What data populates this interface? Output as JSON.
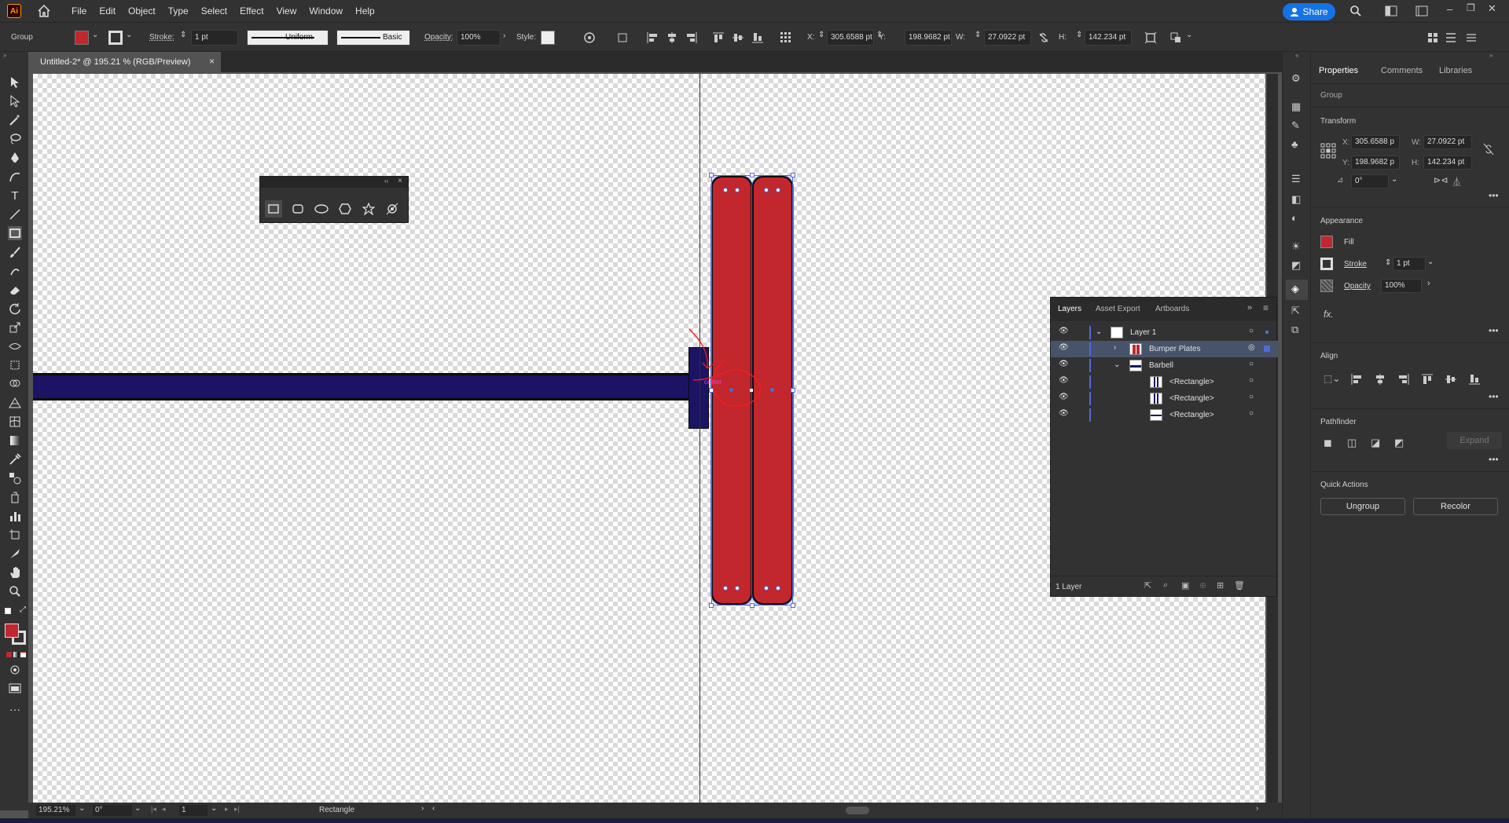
{
  "app": {
    "logo": "Ai",
    "home_icon": "home-icon"
  },
  "menu": [
    "File",
    "Edit",
    "Object",
    "Type",
    "Select",
    "Effect",
    "View",
    "Window",
    "Help"
  ],
  "share_label": "Share",
  "control_bar": {
    "selection_type": "Group",
    "fill_color": "#c1272d",
    "stroke_label": "Stroke:",
    "stroke_value": "1 pt",
    "profile_label": "Uniform",
    "brush_label": "Basic",
    "opacity_label": "Opacity:",
    "opacity_value": "100%",
    "style_label": "Style:",
    "x_label": "X:",
    "x_value": "305.6588 pt",
    "y_label": "Y:",
    "y_value": "198.9682 pt",
    "w_label": "W:",
    "w_value": "27.0922 pt",
    "h_label": "H:",
    "h_value": "142.234 pt"
  },
  "document_tab": {
    "title": "Untitled-2* @ 195.21 % (RGB/Preview)",
    "close": "×"
  },
  "canvas": {
    "bar_color": "#1b1464",
    "plate_color": "#c1272d",
    "annotation_color": "#ff1a1a",
    "center_label": "center"
  },
  "shape_popup": {
    "collapse": "‹‹",
    "close": "×"
  },
  "properties": {
    "tabs": [
      "Properties",
      "Comments",
      "Libraries"
    ],
    "selection": "Group",
    "transform_title": "Transform",
    "x_label": "X:",
    "x_value": "305.6588 p",
    "y_label": "Y:",
    "y_value": "198.9682 p",
    "w_label": "W:",
    "w_value": "27.0922 pt",
    "h_label": "H:",
    "h_value": "142.234 pt",
    "rotate_value": "0°",
    "appearance_title": "Appearance",
    "fill_label": "Fill",
    "stroke_label": "Stroke",
    "stroke_value": "1 pt",
    "opacity_label": "Opacity",
    "opacity_value": "100%",
    "fx_label": "fx.",
    "align_title": "Align",
    "pathfinder_title": "Pathfinder",
    "expand_label": "Expand",
    "quick_actions_title": "Quick Actions",
    "ungroup_label": "Ungroup",
    "recolor_label": "Recolor"
  },
  "layers": {
    "tabs": [
      "Layers",
      "Asset Export",
      "Artboards"
    ],
    "rows": [
      "Layer 1",
      "Bumper Plates",
      "Barbell",
      "<Rectangle>",
      "<Rectangle>",
      "<Rectangle>"
    ],
    "footer": "1 Layer"
  },
  "status": {
    "zoom": "195.21%",
    "rotation": "0°",
    "artboard": "1",
    "tool": "Rectangle"
  }
}
